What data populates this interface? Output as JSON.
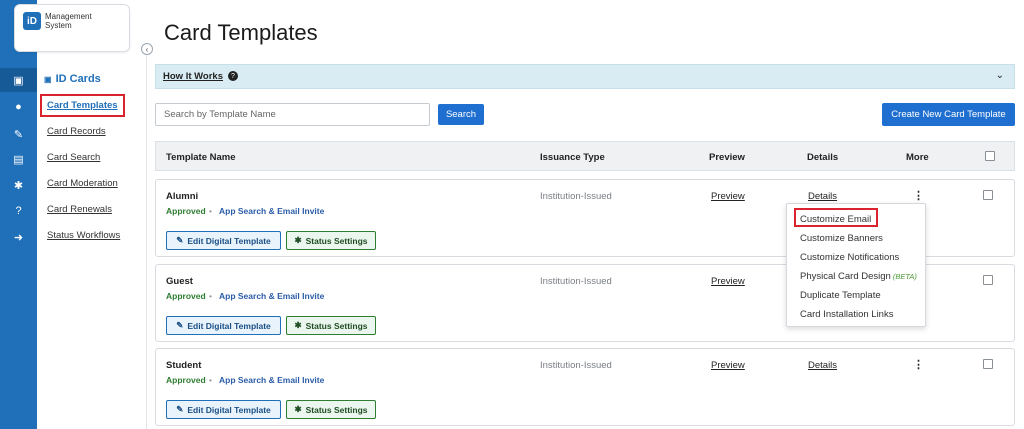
{
  "logo": {
    "mark": "iD",
    "line1": "Management",
    "line2": "System"
  },
  "rail": {
    "icons": [
      "id-card-icon",
      "chat-icon",
      "rocket-icon",
      "document-icon",
      "gear-icon",
      "help-icon",
      "sign-out-icon"
    ],
    "glyphs": [
      "▣",
      "●",
      "✎",
      "▤",
      "✱",
      "?",
      "➜"
    ]
  },
  "sidebar": {
    "section_title": "ID Cards",
    "links": [
      "Card Templates",
      "Card Records",
      "Card Search",
      "Card Moderation",
      "Card Renewals",
      "Status Workflows"
    ]
  },
  "page": {
    "title": "Card Templates"
  },
  "how_it_works": {
    "label": "How It Works",
    "icon": "?",
    "chevron": "⌄"
  },
  "search": {
    "placeholder": "Search by Template Name",
    "button": "Search"
  },
  "create_button": "Create New Card Template",
  "table": {
    "headers": {
      "name": "Template Name",
      "issuance": "Issuance Type",
      "preview": "Preview",
      "details": "Details",
      "more": "More"
    },
    "rows": [
      {
        "name": "Alumni",
        "status": "Approved",
        "method": "App Search & Email Invite",
        "issuance": "Institution-Issued",
        "preview": "Preview",
        "details": "Details",
        "more": "⋮",
        "edit": "Edit Digital Template",
        "status_settings": "Status Settings"
      },
      {
        "name": "Guest",
        "status": "Approved",
        "method": "App Search & Email Invite",
        "issuance": "Institution-Issued",
        "preview": "Preview",
        "details": "",
        "more": "",
        "edit": "Edit Digital Template",
        "status_settings": "Status Settings"
      },
      {
        "name": "Student",
        "status": "Approved",
        "method": "App Search & Email Invite",
        "issuance": "Institution-Issued",
        "preview": "Preview",
        "details": "Details",
        "more": "⋮",
        "edit": "Edit Digital Template",
        "status_settings": "Status Settings"
      }
    ]
  },
  "more_menu": {
    "items": [
      "Customize Email",
      "Customize Banners",
      "Customize Notifications",
      "Physical Card Design",
      "Duplicate Template",
      "Card Installation Links"
    ],
    "beta": "(BETA)"
  },
  "colors": {
    "primary": "#1f6fb9",
    "highlight": "#d9232d",
    "approved": "#2e7d32"
  }
}
